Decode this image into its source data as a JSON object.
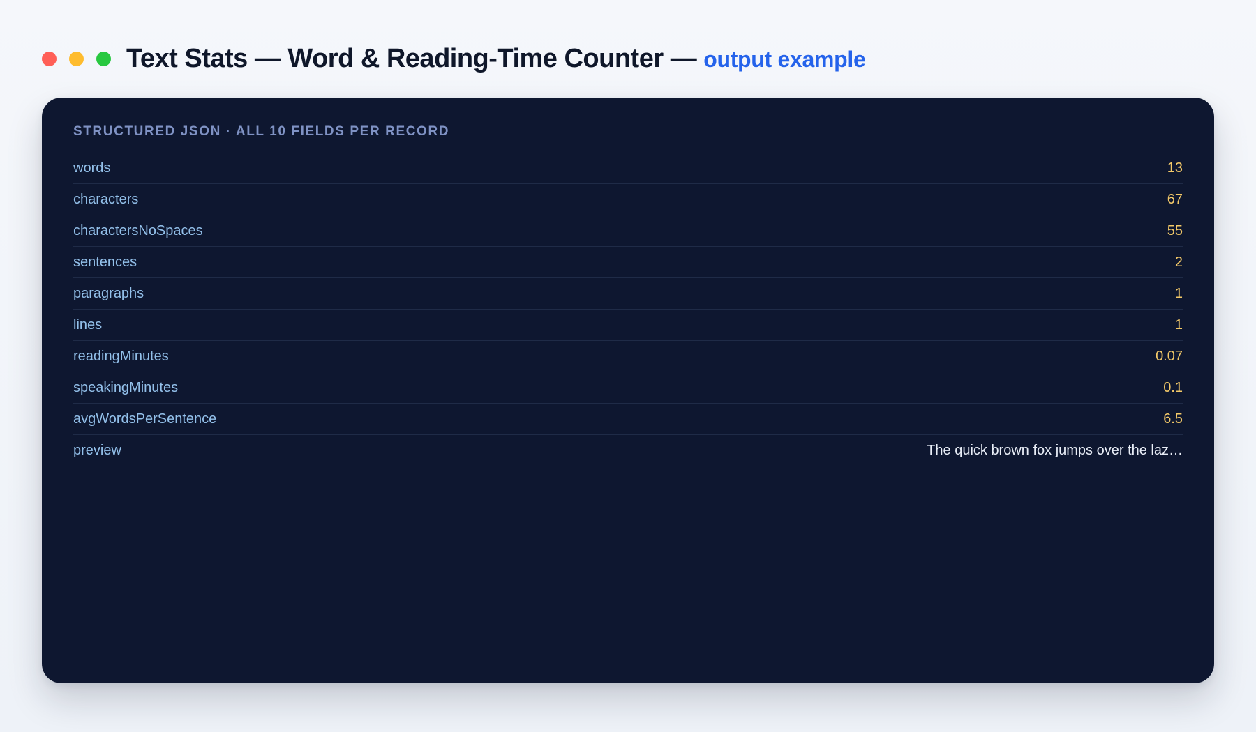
{
  "header": {
    "title": "Text Stats — Word & Reading-Time Counter —",
    "subtitle": "output example"
  },
  "card": {
    "label": "STRUCTURED JSON · ALL 10 FIELDS PER RECORD",
    "rows": [
      {
        "key": "words",
        "value": "13",
        "kind": "number"
      },
      {
        "key": "characters",
        "value": "67",
        "kind": "number"
      },
      {
        "key": "charactersNoSpaces",
        "value": "55",
        "kind": "number"
      },
      {
        "key": "sentences",
        "value": "2",
        "kind": "number"
      },
      {
        "key": "paragraphs",
        "value": "1",
        "kind": "number"
      },
      {
        "key": "lines",
        "value": "1",
        "kind": "number"
      },
      {
        "key": "readingMinutes",
        "value": "0.07",
        "kind": "number"
      },
      {
        "key": "speakingMinutes",
        "value": "0.1",
        "kind": "number"
      },
      {
        "key": "avgWordsPerSentence",
        "value": "6.5",
        "kind": "number"
      },
      {
        "key": "preview",
        "value": "The quick brown fox jumps over the laz…",
        "kind": "text"
      }
    ]
  },
  "colors": {
    "number_value": "#f3c969",
    "text_value": "#e8edf6",
    "key": "#93c0ea",
    "accent": "#2563eb",
    "card_background": "#0e1730"
  },
  "icons": [
    "window-close-dot-icon",
    "window-minimize-dot-icon",
    "window-maximize-dot-icon"
  ]
}
